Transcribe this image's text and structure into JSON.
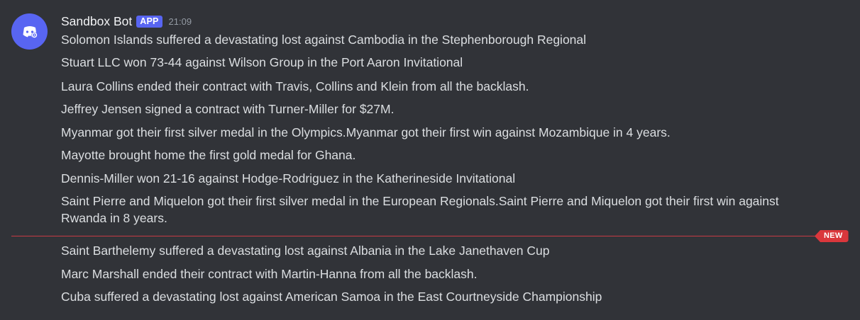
{
  "message_group": {
    "username": "Sandbox Bot",
    "badge": "APP",
    "timestamp": "21:09",
    "avatar_icon": "discord-bot-icon",
    "accent_color": "#5865f2"
  },
  "messages": [
    "Solomon Islands suffered a devastating lost against Cambodia in the Stephenborough Regional",
    "Stuart LLC won 73-44 against Wilson Group in the Port Aaron Invitational",
    "Laura Collins ended their contract with Travis, Collins and Klein from all the backlash.",
    "Jeffrey Jensen signed a contract with Turner-Miller for $27M.",
    "Myanmar got their first silver medal in the Olympics.Myanmar got their first win against Mozambique in 4 years.",
    "Mayotte brought home the first gold medal for Ghana.",
    "Dennis-Miller won 21-16 against Hodge-Rodriguez in the Katherineside Invitational",
    "Saint Pierre and Miquelon got their first silver medal in the European Regionals.Saint Pierre and Miquelon got their first win against Rwanda in 8 years."
  ],
  "new_divider": {
    "label": "NEW",
    "color": "#da373c"
  },
  "new_messages": [
    "Saint Barthelemy suffered a devastating lost against Albania in the Lake Janethaven Cup",
    "Marc Marshall ended their contract with Martin-Hanna from all the backlash.",
    "Cuba suffered a devastating lost against American Samoa in the East Courtneyside Championship"
  ]
}
